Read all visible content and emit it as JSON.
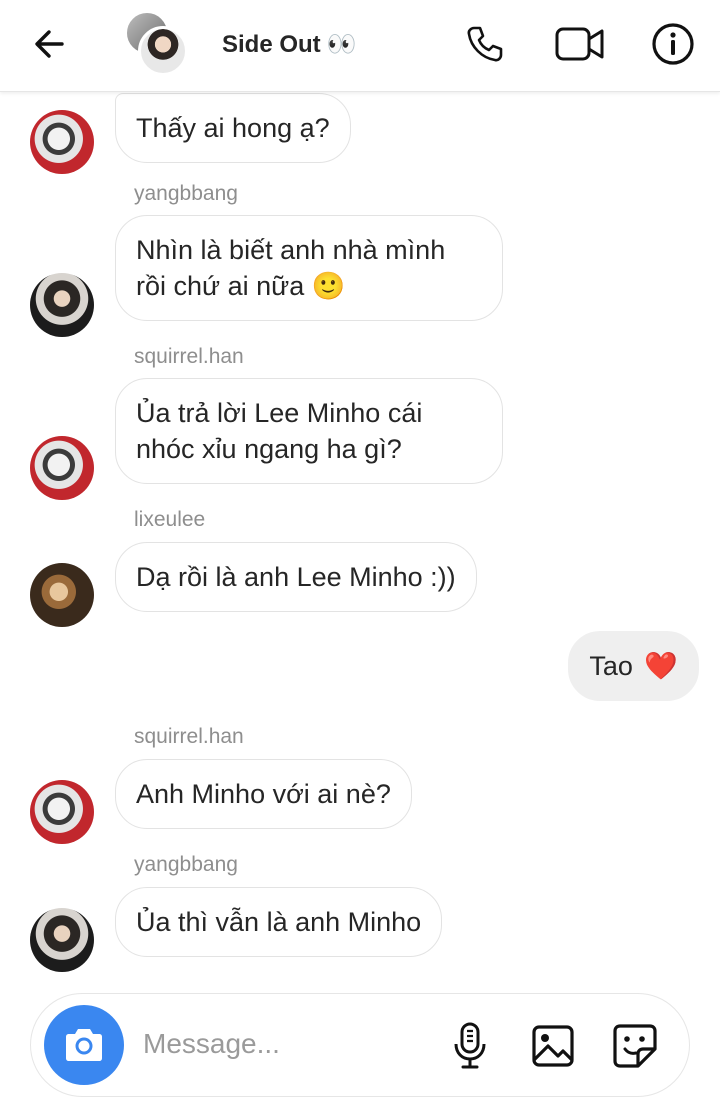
{
  "header": {
    "title": "Side Out",
    "title_emoji": "👀"
  },
  "messages": [
    {
      "sender": "",
      "avatar": "red",
      "text": "Thấy ai hong ạ?"
    },
    {
      "sender": "yangbbang",
      "avatar": "dark",
      "text_line1": "Nhìn là biết anh nhà mình",
      "text_line2": "rồi chứ ai nữa 🙂"
    },
    {
      "sender": "squirrel.han",
      "avatar": "red",
      "text_line1": "Ủa trả lời Lee Minho cái",
      "text_line2": "nhóc xỉu ngang ha gì?"
    },
    {
      "sender": "lixeulee",
      "avatar": "brown",
      "text": "Dạ rồi là anh Lee Minho :))"
    },
    {
      "sender": "",
      "mine": true,
      "text": "Tao",
      "emoji": "❤️"
    },
    {
      "sender": "squirrel.han",
      "avatar": "red",
      "text": "Anh Minho với ai nè?"
    },
    {
      "sender": "yangbbang",
      "avatar": "dark",
      "text": "Ủa thì vẫn là anh Minho"
    }
  ],
  "composer": {
    "placeholder": "Message..."
  },
  "icons": {
    "back": "arrow-left-icon",
    "phone": "phone-icon",
    "video": "video-camera-icon",
    "info": "info-icon",
    "camera": "camera-icon",
    "mic": "microphone-icon",
    "gallery": "image-icon",
    "sticker": "sticker-icon"
  },
  "colors": {
    "accent": "#3a87f0",
    "heart": "#d8232a",
    "sender_text": "#8e8e8e",
    "my_bubble": "#efefef"
  }
}
